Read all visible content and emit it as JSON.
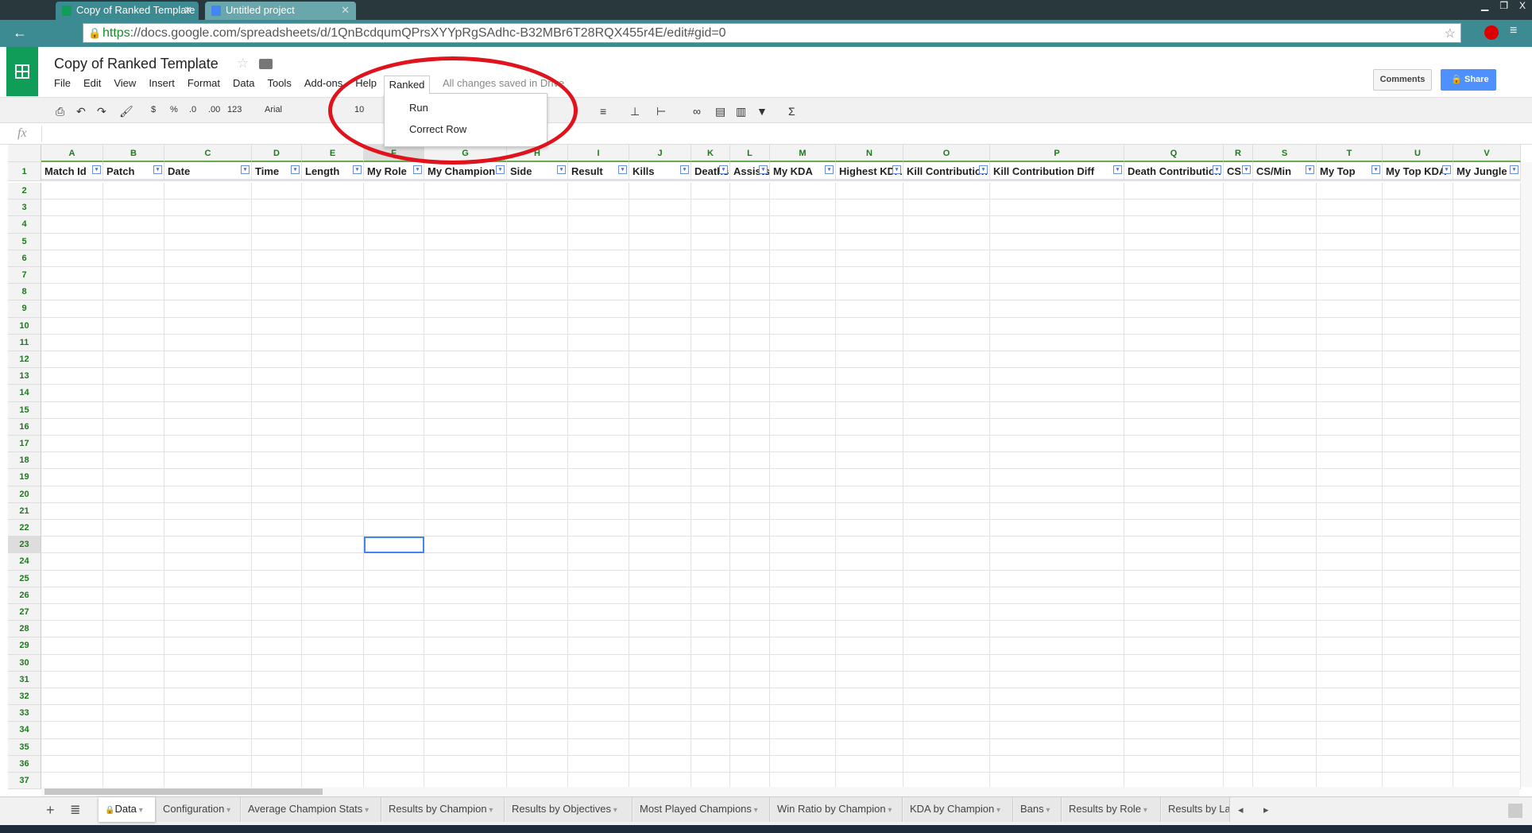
{
  "browser": {
    "tabs": [
      {
        "label": "Copy of Ranked Template"
      },
      {
        "label": "Untitled project"
      }
    ],
    "url_scheme": "https",
    "url_rest": "://docs.google.com/spreadsheets/d/1QnBcdqumQPrsXYYpRgSAdhc-B32MBr6T28RQX455r4E/edit#gid=0"
  },
  "doc": {
    "title": "Copy of Ranked Template",
    "save_status": "All changes saved in Drive"
  },
  "menu": [
    "File",
    "Edit",
    "View",
    "Insert",
    "Format",
    "Data",
    "Tools",
    "Add-ons",
    "Help"
  ],
  "ranked_menu": {
    "label": "Ranked",
    "items": [
      "Run",
      "Correct Row"
    ]
  },
  "header_buttons": {
    "comments": "Comments",
    "share": "Share"
  },
  "toolbar": {
    "currency": "$",
    "percent": "%",
    "dec_less": ".0",
    "dec_more": ".00",
    "format": "123",
    "font": "Arial",
    "size": "10",
    "sum": "Σ"
  },
  "formula_bar": {
    "fx": "fx",
    "value": ""
  },
  "columns": [
    "A",
    "B",
    "C",
    "D",
    "E",
    "F",
    "G",
    "H",
    "I",
    "J",
    "K",
    "L",
    "M",
    "N",
    "O",
    "P",
    "Q",
    "R",
    "S",
    "T",
    "U",
    "V"
  ],
  "headers": [
    "Match Id",
    "Patch",
    "Date",
    "Time",
    "Length",
    "My Role",
    "My Champion",
    "Side",
    "Result",
    "Kills",
    "Deaths",
    "Assists",
    "My KDA",
    "Highest KDA",
    "Kill Contribution",
    "Kill Contribution Diff",
    "Death Contribution",
    "CS",
    "CS/Min",
    "My Top",
    "My Top KDA",
    "My Jungle"
  ],
  "row_numbers": [
    1,
    2,
    3,
    4,
    5,
    6,
    7,
    8,
    9,
    10,
    11,
    12,
    13,
    14,
    15,
    16,
    17,
    18,
    19,
    20,
    21,
    22,
    23,
    24,
    25,
    26,
    27,
    28,
    29,
    30,
    31,
    32,
    33,
    34,
    35,
    36,
    37
  ],
  "selected_cell": "F23",
  "sheets": [
    "Data",
    "Configuration",
    "Average Champion Stats",
    "Results by Champion",
    "Results by Objectives",
    "Most Played Champions",
    "Win Ratio by Champion",
    "KDA by Champion",
    "Bans",
    "Results by Role",
    "Results by La"
  ],
  "colors": {
    "accent": "#0f9d58",
    "share": "#4d90fe",
    "annotation": "#e0121c"
  }
}
